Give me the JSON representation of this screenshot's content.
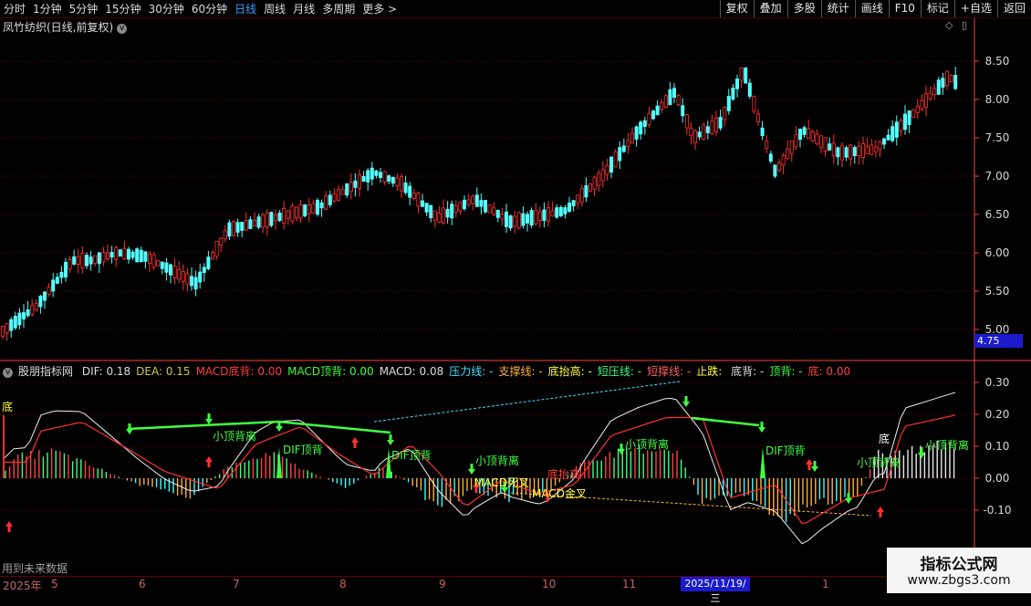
{
  "toolbar": {
    "periods": [
      "分时",
      "1分钟",
      "5分钟",
      "15分钟",
      "30分钟",
      "60分钟",
      "日线",
      "周线",
      "月线",
      "多周期",
      "更多 >"
    ],
    "active_period": "日线",
    "buttons": [
      "复权",
      "叠加",
      "多股",
      "统计",
      "画线",
      "F10",
      "标记",
      "+自选",
      "返回"
    ]
  },
  "stock": {
    "title": "凤竹纺织(日线,前复权)"
  },
  "main_chart": {
    "y_ticks": [
      "8.50",
      "8.00",
      "7.50",
      "7.00",
      "6.50",
      "6.00",
      "5.50",
      "5.00"
    ],
    "current_price_tag": "4.75"
  },
  "indicator": {
    "name": "股朋指标网",
    "fields": [
      {
        "label": "DIF:",
        "value": "0.18",
        "color": "#dcdcdc"
      },
      {
        "label": "DEA:",
        "value": "0.15",
        "color": "#c8c84a"
      },
      {
        "label": "MACD底背:",
        "value": "0.00",
        "color": "#ff3c3c"
      },
      {
        "label": "MACD顶背:",
        "value": "0.00",
        "color": "#3cff3c"
      },
      {
        "label": "MACD:",
        "value": "0.08",
        "color": "#dcdcdc"
      },
      {
        "label": "压力线:",
        "value": "-",
        "color": "#40e0ff"
      },
      {
        "label": "支撑线:",
        "value": "-",
        "color": "#ffb040"
      },
      {
        "label": "底抬高:",
        "value": "-",
        "color": "#ffff40"
      },
      {
        "label": "短压线:",
        "value": "-",
        "color": "#40ff80"
      },
      {
        "label": "短撑线:",
        "value": "-",
        "color": "#ff6060"
      },
      {
        "label": "止跌:",
        "value": "",
        "color": "#ffff40"
      },
      {
        "label": "底背:",
        "value": "-",
        "color": "#dcdcdc"
      },
      {
        "label": "顶背:",
        "value": "-",
        "color": "#3cff3c"
      },
      {
        "label": "底:",
        "value": "0.00",
        "color": "#ff4040"
      }
    ],
    "y_ticks": [
      "0.30",
      "0.20",
      "0.10",
      "0.00",
      "-0.10"
    ],
    "labels": {
      "di_left": "底",
      "di_right": "底",
      "small_top_div": "小顶背离",
      "dif_top_div": "DIF顶背",
      "macd_death": "MACD死叉",
      "macd_golden": "MACD金叉",
      "bottom_raise": "底抬高"
    }
  },
  "footer": {
    "note": "用到未来数据",
    "dates": [
      "2025年",
      "5",
      "6",
      "7",
      "8",
      "9",
      "10",
      "11",
      "1"
    ],
    "highlight_date": "2025/11/19/三"
  },
  "watermark": {
    "title": "指标公式网",
    "url": "www.zbgs3.com"
  },
  "colors": {
    "up": "#ff3030",
    "down": "#54ffff",
    "grid": "#7a0000",
    "axis": "#ff3c3c"
  }
}
